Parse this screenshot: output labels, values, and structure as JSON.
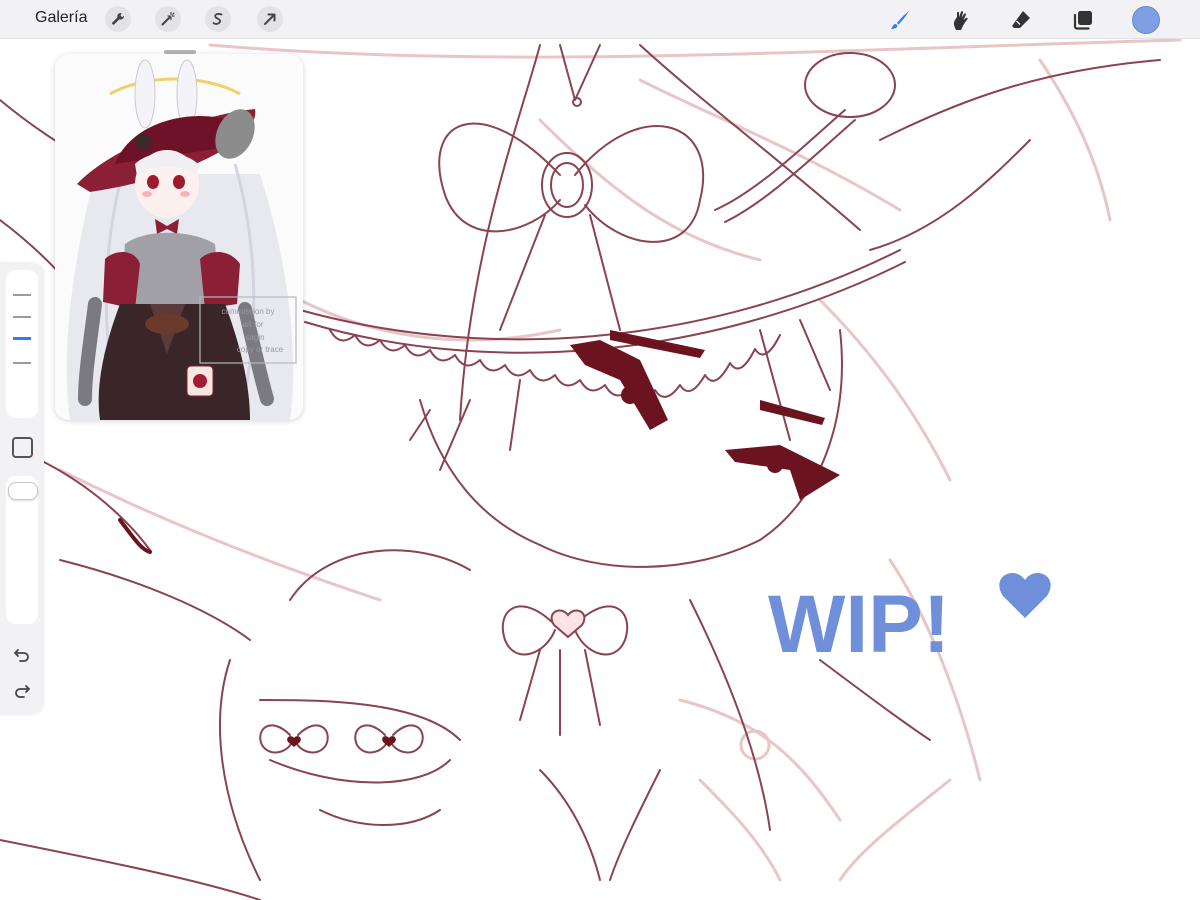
{
  "toolbar": {
    "gallery_label": "Galería",
    "left_tools": [
      {
        "icon": "wrench-icon",
        "name": "actions"
      },
      {
        "icon": "magic-wand-icon",
        "name": "adjustments"
      },
      {
        "icon": "selection-icon",
        "name": "selection"
      },
      {
        "icon": "arrow-cursor-icon",
        "name": "transform"
      }
    ],
    "right_tools": [
      {
        "icon": "brush-icon",
        "name": "paint",
        "active": true
      },
      {
        "icon": "smudge-icon",
        "name": "smudge"
      },
      {
        "icon": "eraser-icon",
        "name": "erase"
      },
      {
        "icon": "layers-icon",
        "name": "layers"
      }
    ],
    "current_color": "#7f9fe3",
    "active_color": "#2f7ef6"
  },
  "reference": {
    "watermark_lines": [
      "commission by",
      "art for",
      "sagin",
      "copy or trace"
    ]
  },
  "sidebar": {
    "brush_size_level": 0.55,
    "opacity_level": 1.0
  },
  "canvas": {
    "annotation": "WIP!",
    "annotation_color": "#6f8fdb",
    "lineart_color": "#8a4350",
    "sketch_color": "#e9c6c6"
  }
}
